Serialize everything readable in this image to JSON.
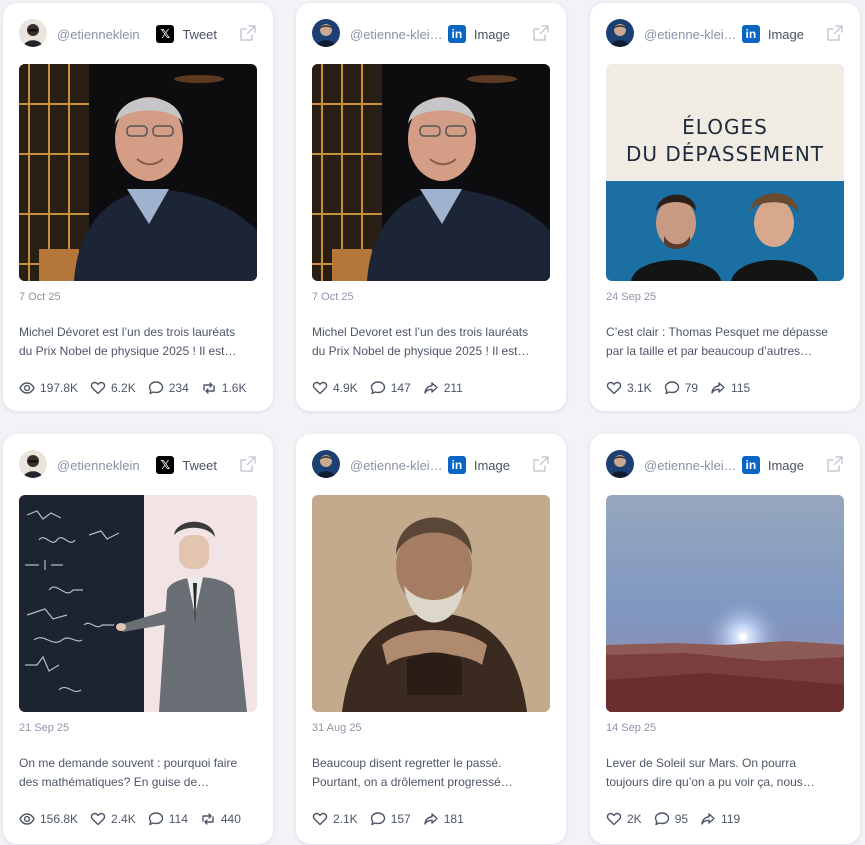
{
  "cards": [
    {
      "handle": "@etienneklein",
      "platform": "Tweet",
      "date": "7 Oct 25",
      "text_line1": "Michel Dévoret est l’un des trois lauréats",
      "text_line2": "du Prix Nobel de physique 2025 ! Il est…",
      "stats": {
        "views": "197.8K",
        "likes": "6.2K",
        "comments": "234",
        "reposts": "1.6K"
      },
      "image": "portrait-nobel-laureate",
      "platform_icon": "x-logo-icon"
    },
    {
      "handle": "@etienne-klei…",
      "platform": "Image",
      "date": "7 Oct 25",
      "text_line1": "Michel Devoret est l’un des trois lauréats",
      "text_line2": "du Prix Nobel de physique 2025 ! Il est…",
      "stats": {
        "likes": "4.9K",
        "comments": "147",
        "shares": "211"
      },
      "image": "portrait-nobel-laureate",
      "platform_icon": "linkedin-logo-icon"
    },
    {
      "handle": "@etienne-klei…",
      "platform": "Image",
      "date": "24 Sep 25",
      "text_line1": "C’est clair : Thomas Pesquet me dépasse",
      "text_line2": "par la taille et par beaucoup d’autres…",
      "stats": {
        "likes": "3.1K",
        "comments": "79",
        "shares": "115"
      },
      "image": "book-cover",
      "cover_title_line1": "ÉLOGES",
      "cover_title_line2": "DU DÉPASSEMENT",
      "platform_icon": "linkedin-logo-icon"
    },
    {
      "handle": "@etienneklein",
      "platform": "Tweet",
      "date": "21 Sep 25",
      "text_line1": "On me demande souvent : pourquoi faire",
      "text_line2": "des mathématiques? En guise de…",
      "stats": {
        "views": "156.8K",
        "likes": "2.4K",
        "comments": "114",
        "reposts": "440"
      },
      "image": "blackboard-photo",
      "platform_icon": "x-logo-icon"
    },
    {
      "handle": "@etienne-klei…",
      "platform": "Image",
      "date": "31 Aug 25",
      "text_line1": "Beaucoup disent regretter le passé.",
      "text_line2": "Pourtant, on a drôlement progressé…",
      "stats": {
        "likes": "2.1K",
        "comments": "157",
        "shares": "181"
      },
      "image": "sepia-portrait",
      "platform_icon": "linkedin-logo-icon"
    },
    {
      "handle": "@etienne-klei…",
      "platform": "Image",
      "date": "14 Sep 25",
      "text_line1": "Lever de Soleil sur Mars. On pourra",
      "text_line2": "toujours dire qu’on a pu voir ça, nous…",
      "stats": {
        "likes": "2K",
        "comments": "95",
        "shares": "119"
      },
      "image": "mars-sunrise",
      "platform_icon": "linkedin-logo-icon"
    }
  ],
  "colors": {
    "x_brand": "#000000",
    "linkedin_brand": "#0a66c2",
    "background": "#f1f3f7"
  }
}
